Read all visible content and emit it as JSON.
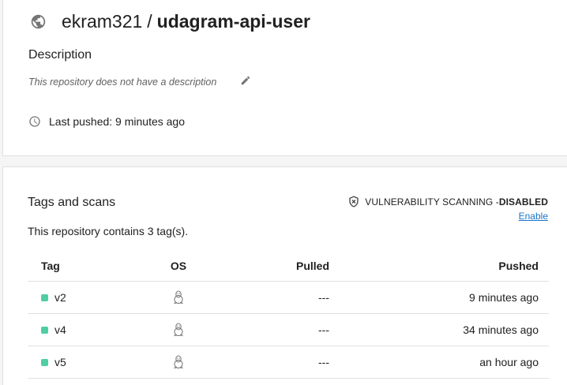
{
  "repo": {
    "owner": "ekram321",
    "separator": "/",
    "name": "udagram-api-user"
  },
  "description": {
    "heading": "Description",
    "text": "This repository does not have a description"
  },
  "last_pushed": "Last pushed: 9 minutes ago",
  "tags_section": {
    "heading": "Tags and scans",
    "count_text": "This repository contains 3 tag(s).",
    "vulnerability_label": "VULNERABILITY SCANNING - ",
    "vulnerability_status": "DISABLED",
    "enable_link": "Enable",
    "columns": {
      "tag": "Tag",
      "os": "OS",
      "pulled": "Pulled",
      "pushed": "Pushed"
    },
    "rows": [
      {
        "tag": "v2",
        "os": "linux",
        "pulled": "---",
        "pushed": "9 minutes ago"
      },
      {
        "tag": "v4",
        "os": "linux",
        "pulled": "---",
        "pushed": "34 minutes ago"
      },
      {
        "tag": "v5",
        "os": "linux",
        "pulled": "---",
        "pushed": "an hour ago"
      }
    ]
  },
  "colors": {
    "tag_status": "#4fcea6",
    "link": "#1a73c8",
    "icon": "#757575"
  },
  "icons": {
    "visibility": "globe-icon",
    "edit": "pencil-icon",
    "time": "clock-icon",
    "security": "shield-icon",
    "os": "linux-icon"
  }
}
